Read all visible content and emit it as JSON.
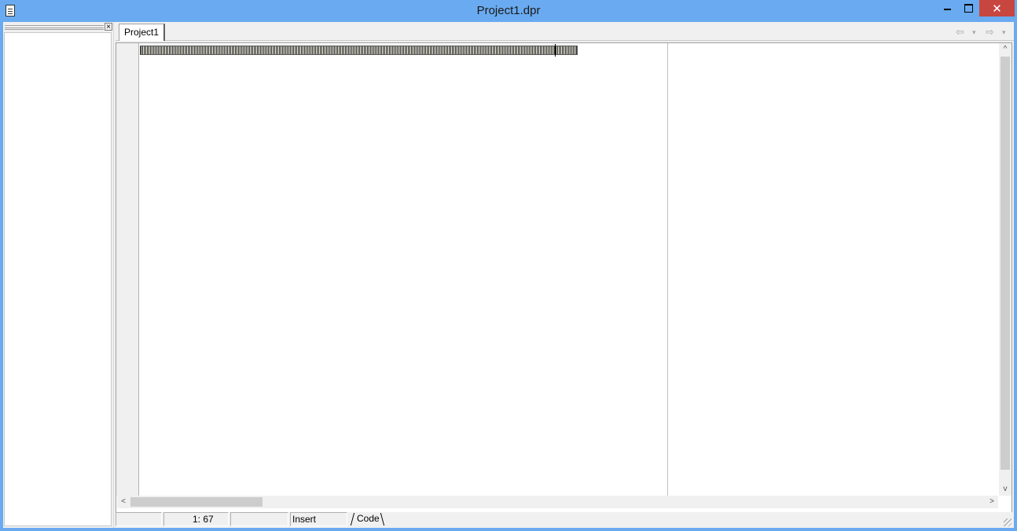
{
  "window": {
    "title": "Project1.dpr",
    "minimize_icon": "minimize-icon",
    "maximize_icon": "maximize-icon",
    "close_glyph": "✕"
  },
  "left_panel": {
    "close_glyph": "×"
  },
  "tabs": [
    {
      "label": "Project1",
      "active": true
    }
  ],
  "nav": {
    "back_glyph": "⇦",
    "forward_glyph": "⇨",
    "dropdown_glyph": "▾"
  },
  "status": {
    "position": "1:  67",
    "mode": "Insert",
    "view_tab": "Code"
  },
  "scrollbars": {
    "up_glyph": "^",
    "down_glyph": "v",
    "left_glyph": "<",
    "right_glyph": ">"
  },
  "colors": {
    "title_bar": "#6aaaf0",
    "close_button": "#c7463f"
  }
}
